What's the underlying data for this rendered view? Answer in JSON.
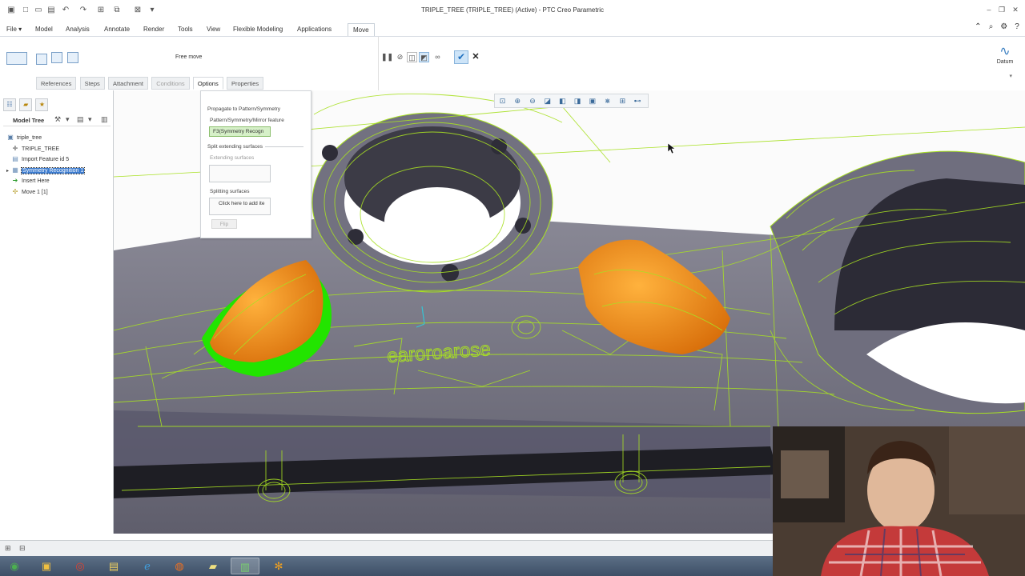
{
  "window": {
    "title": "TRIPLE_TREE (TRIPLE_TREE) (Active) - PTC Creo Parametric"
  },
  "menu": {
    "items": [
      "File",
      "Model",
      "Analysis",
      "Annotate",
      "Render",
      "Tools",
      "View",
      "Flexible Modeling",
      "Applications",
      "Move"
    ],
    "active": "Move"
  },
  "ribbon": {
    "free_move": "Free move",
    "datum_label": "Datum"
  },
  "subtabs": {
    "items": [
      "References",
      "Steps",
      "Attachment",
      "Conditions",
      "Options",
      "Properties"
    ],
    "active": "Options"
  },
  "model_tree": {
    "header": "Model Tree",
    "items": [
      "triple_tree",
      "TRIPLE_TREE",
      "Import Feature id 5",
      "Symmetry Recognition 1",
      "Insert Here",
      "Move 1 [1]"
    ]
  },
  "options_panel": {
    "propagate_label": "Propagate to Pattern/Symmetry",
    "pattern_label": "Pattern/Symmetry/Mirror feature",
    "pattern_value": "F3(Symmetry Recogn",
    "split_label": "Split extending surfaces",
    "extending_label": "Extending surfaces",
    "splitting_label": "Splitting surfaces",
    "splitting_value": "Click here to add ite",
    "flip_label": "Flip"
  },
  "model": {
    "engraving": "earoroarose"
  },
  "colors": {
    "accent": "#3d7ccf",
    "wireframe": "#a8e023",
    "body": "#6e6d7b",
    "highlight": "#f2911b",
    "selection": "#22e400"
  }
}
